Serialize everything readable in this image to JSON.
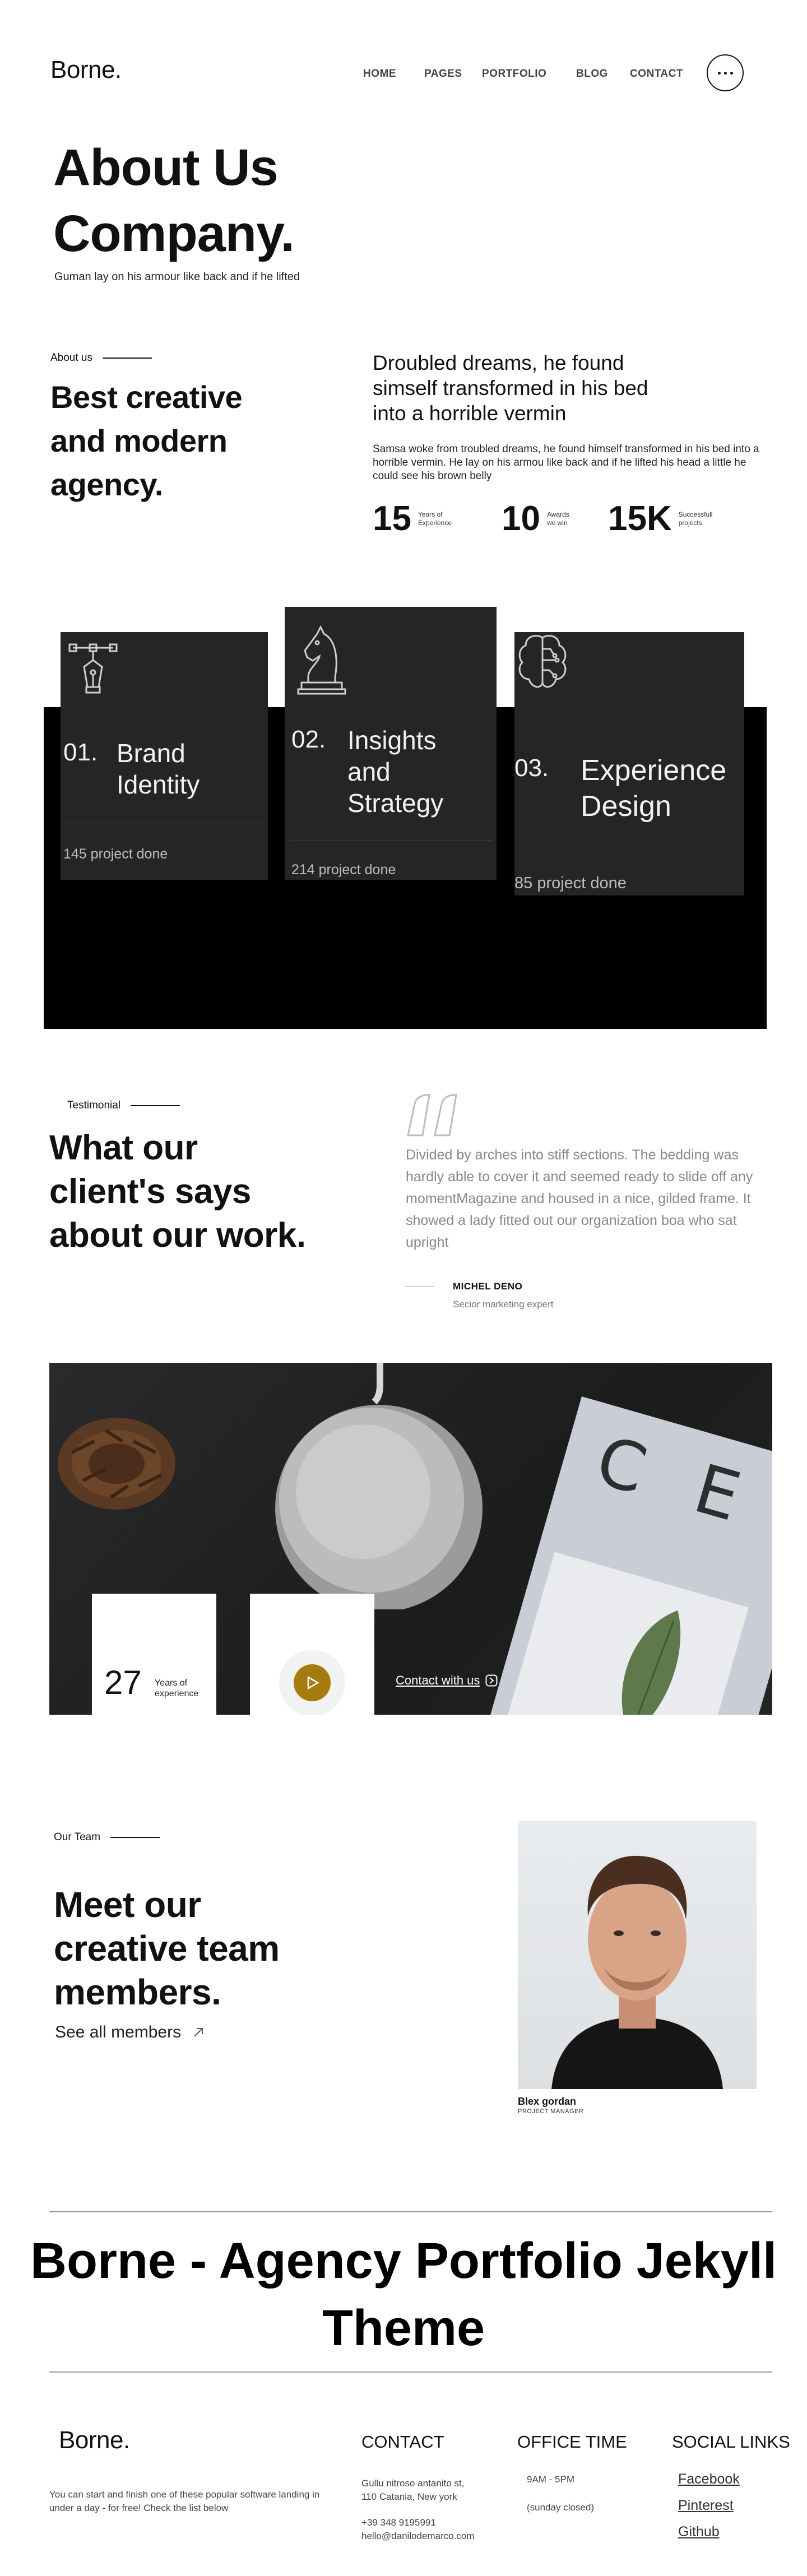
{
  "header": {
    "logo": "Borne.",
    "nav": [
      "HOME",
      "PAGES",
      "PORTFOLIO",
      "BLOG",
      "CONTACT"
    ]
  },
  "hero": {
    "title_line1": "About Us",
    "title_line2": "Company.",
    "subtitle": "Guman lay on his armour like back and if he lifted"
  },
  "about": {
    "eyebrow": "About us",
    "heading_line1": "Best creative",
    "heading_line2": "and modern",
    "heading_line3": "agency.",
    "lead_line1": "Droubled dreams, he found",
    "lead_line2": "simself transformed in his bed",
    "lead_line3": "into a horrible vermin",
    "paragraph": "Samsa woke from troubled dreams, he found himself transformed in his bed into a horrible vermin. He lay on his armou like back and if he lifted his head a little he could see his brown belly",
    "stats": [
      {
        "value": "15",
        "label_line1": "Years of",
        "label_line2": "Experience"
      },
      {
        "value": "10",
        "label_line1": "Awards",
        "label_line2": "we win"
      },
      {
        "value": "15K",
        "label_line1": "Successfull",
        "label_line2": "projects"
      }
    ]
  },
  "services": [
    {
      "icon": "pen-nib-icon",
      "number": "01.",
      "name_line1": "Brand",
      "name_line2": "Identity",
      "name_line3": "",
      "count": "145 project done"
    },
    {
      "icon": "chess-knight-icon",
      "number": "02.",
      "name_line1": "Insights",
      "name_line2": "and",
      "name_line3": "Strategy",
      "count": "214 project done"
    },
    {
      "icon": "brain-icon",
      "number": "03.",
      "name_line1": "Experience",
      "name_line2": "Design",
      "name_line3": "",
      "count": "85 project done"
    }
  ],
  "testimonial": {
    "eyebrow": "Testimonial",
    "heading_line1": "What our",
    "heading_line2": "client's says",
    "heading_line3": "about our work.",
    "quote_line1": "Divided by arches into stiff sections. The bedding was",
    "quote_line2": "hardly able to cover it and seemed ready to slide off any",
    "quote_line3": "momentMagazine and housed in a nice, gilded frame. It",
    "quote_line4": "showed a lady fitted out our organization boa who sat",
    "quote_line5": "upright",
    "author_name": "MICHEL DENO",
    "author_role": "Secior marketing expert"
  },
  "banner": {
    "years_value": "27",
    "years_label_line1": "Years of",
    "years_label_line2": "experience",
    "contact_link": "Contact with us",
    "book_letters": "C E"
  },
  "team": {
    "eyebrow": "Our Team",
    "heading_line1": "Meet our",
    "heading_line2": "creative team",
    "heading_line3": "members.",
    "see_all": "See all members",
    "member_name": "Blex gordan",
    "member_role": "PROJECT MANAGER"
  },
  "cta": {
    "line1": "Borne - Agency Portfolio Jekyll",
    "line2": "Theme"
  },
  "footer": {
    "logo": "Borne.",
    "blurb_line1": "You can start and finish one of these popular software landing in",
    "blurb_line2": "under a day - for free! Check the list below",
    "contact_title": "CONTACT",
    "address_line1": "Gullu nitroso antanito st,",
    "address_line2": "110 Catania, New york",
    "phone": "+39 348 9195991",
    "email": "hello@danilodemarco.com",
    "office_title": "OFFICE TIME",
    "hours": "9AM - 5PM",
    "closed": "(sunday closed)",
    "social_title": "SOCIAL LINKS",
    "social": [
      "Facebook",
      "Pinterest",
      "Github"
    ]
  },
  "colors": {
    "accent_gold": "#a47b0c",
    "dark_card": "#252525",
    "band": "#000000"
  }
}
